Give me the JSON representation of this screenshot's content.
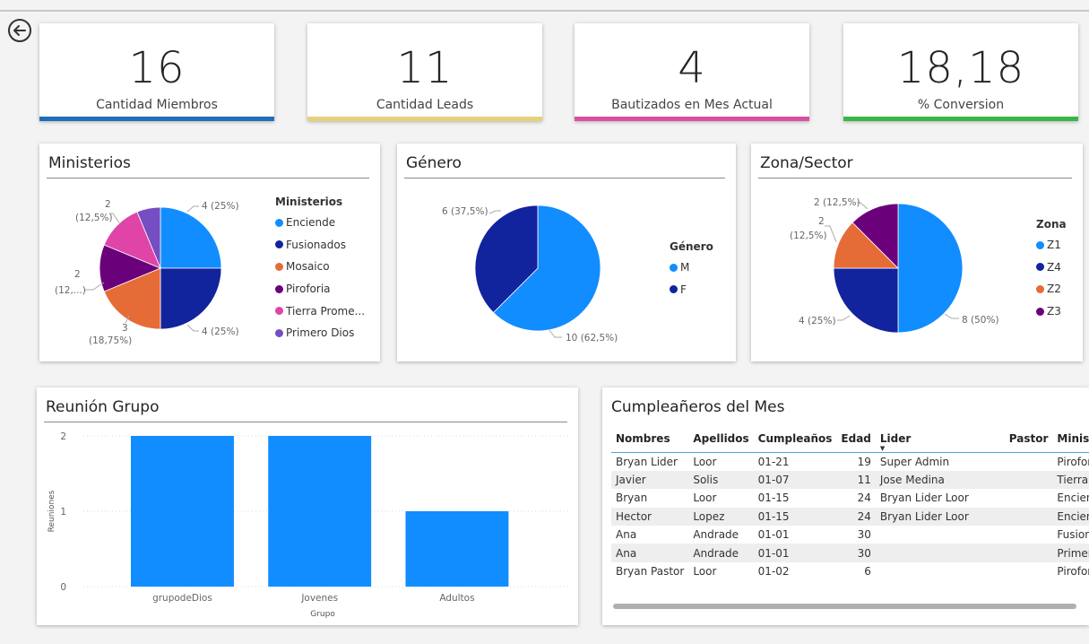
{
  "kpis": [
    {
      "value": "16",
      "label": "Cantidad Miembros",
      "color": "#1f6eb8"
    },
    {
      "value": "11",
      "label": "Cantidad Leads",
      "color": "#e6d27a"
    },
    {
      "value": "4",
      "label": "Bautizados en Mes Actual",
      "color": "#d94fa3"
    },
    {
      "value": "18,18",
      "label": "% Conversion",
      "color": "#3bb54a"
    }
  ],
  "ministerios": {
    "title": "Ministerios",
    "legend_title": "Ministerios",
    "legend": [
      "Enciende",
      "Fusionados",
      "Mosaico",
      "Piroforia",
      "Tierra Prome...",
      "Primero Dios"
    ],
    "labels": [
      "4 (25%)",
      "4 (25%)",
      "3",
      "(18,75%)",
      "2",
      "(12,...)",
      "2",
      "(12,5%)"
    ],
    "colors": [
      "#118dff",
      "#12239e",
      "#e66c37",
      "#6b007b",
      "#e044a7",
      "#744ec2"
    ]
  },
  "genero": {
    "title": "Género",
    "legend_title": "Género",
    "legend": [
      "M",
      "F"
    ],
    "labels": [
      "6 (37,5%)",
      "10 (62,5%)"
    ],
    "colors": [
      "#118dff",
      "#12239e"
    ]
  },
  "zona": {
    "title": "Zona/Sector",
    "legend_title": "Zona",
    "legend": [
      "Z1",
      "Z4",
      "Z2",
      "Z3"
    ],
    "labels": [
      "2 (12,5%)",
      "2",
      "(12,5%)",
      "4 (25%)",
      "8 (50%)"
    ],
    "colors": [
      "#118dff",
      "#12239e",
      "#e66c37",
      "#6b007b"
    ]
  },
  "reunion": {
    "title": "Reunión Grupo"
  },
  "chart_data": {
    "type": "bar",
    "categories": [
      "grupodeDios",
      "Jovenes",
      "Adultos"
    ],
    "values": [
      2,
      2,
      1
    ],
    "xlabel": "Grupo",
    "ylabel": "Reuniones",
    "ylim": [
      0,
      2
    ],
    "yticks": [
      "0",
      "1",
      "2"
    ],
    "color": "#118dff",
    "grid": true
  },
  "birthdays": {
    "title": "Cumpleañeros del Mes",
    "headers": [
      "Nombres",
      "Apellidos",
      "Cumpleaños",
      "Edad",
      "Lider",
      "Pastor",
      "Ministerio"
    ],
    "rows": [
      [
        "Bryan Lider",
        "Loor",
        "01-21",
        "19",
        "Super Admin",
        "",
        "Piroforia"
      ],
      [
        "Javier",
        "Solis",
        "01-07",
        "11",
        "Jose Medina",
        "",
        "Tierra Prometid"
      ],
      [
        "Bryan",
        "Loor",
        "01-15",
        "24",
        "Bryan Lider Loor",
        "",
        "Enciende"
      ],
      [
        "Hector",
        "Lopez",
        "01-15",
        "24",
        "Bryan Lider Loor",
        "",
        "Enciende"
      ],
      [
        "Ana",
        "Andrade",
        "01-01",
        "30",
        "",
        "",
        "Fusionados"
      ],
      [
        "Ana",
        "Andrade",
        "01-01",
        "30",
        "",
        "",
        "Primero Dios"
      ],
      [
        "Bryan Pastor",
        "Loor",
        "01-02",
        "6",
        "",
        "",
        "Piroforia"
      ]
    ]
  }
}
